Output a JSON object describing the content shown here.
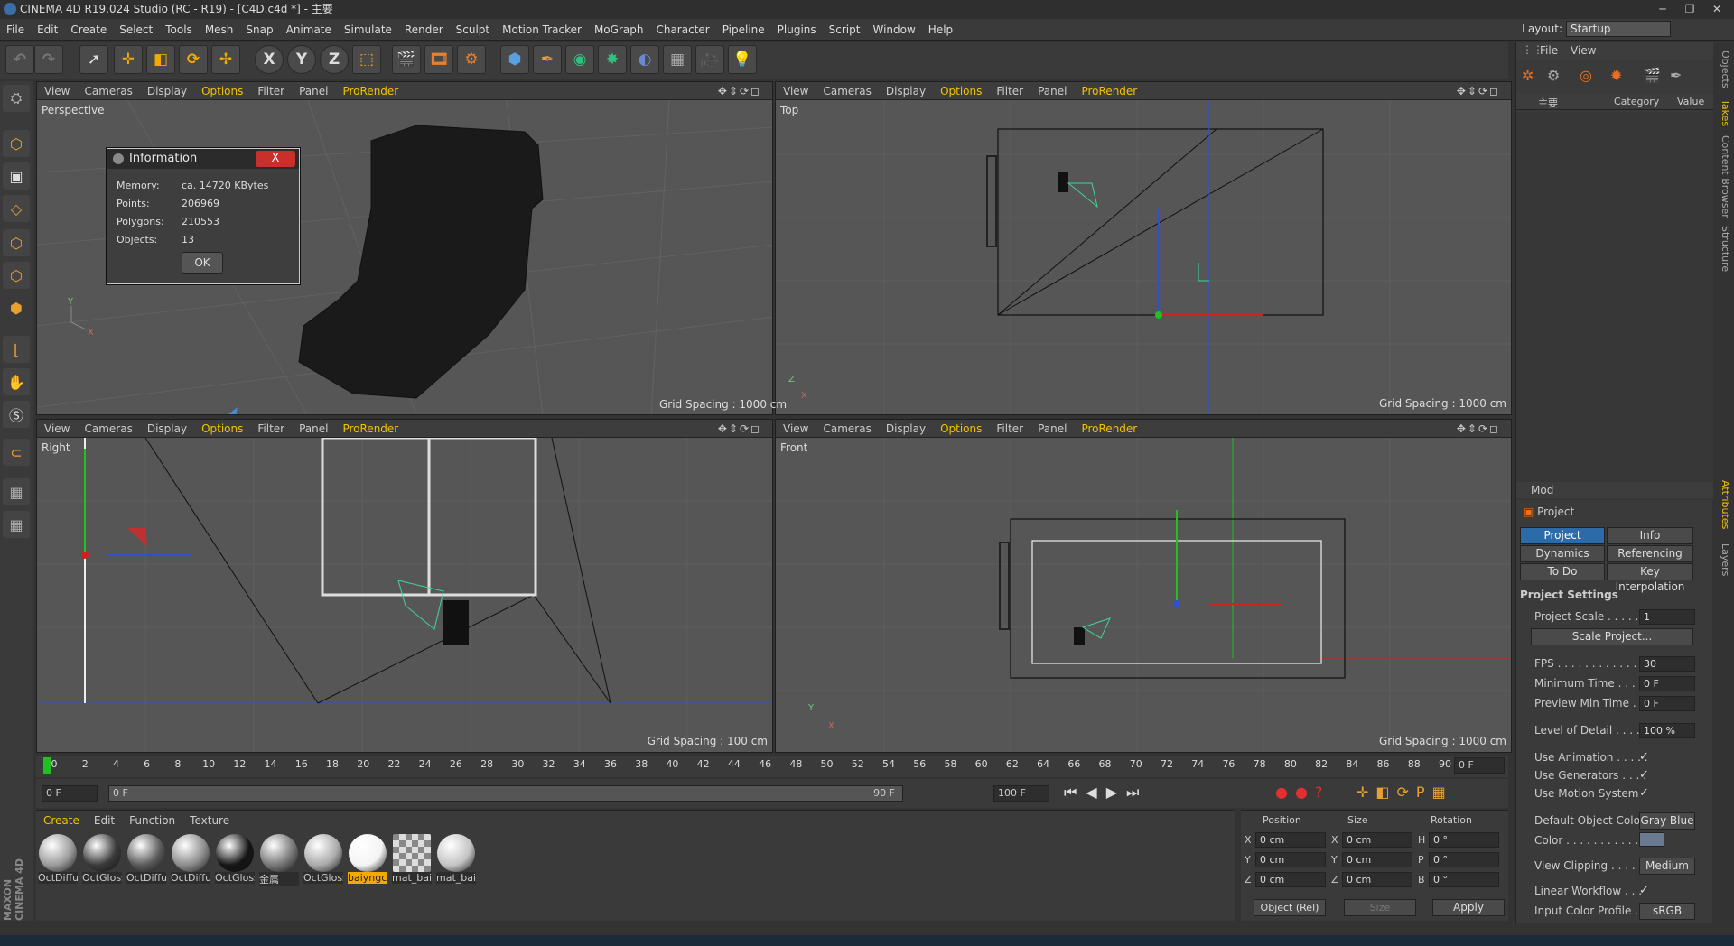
{
  "window": {
    "title": "CINEMA 4D R19.024 Studio (RC - R19) - [C4D.c4d *] - 主要"
  },
  "menu": [
    "File",
    "Edit",
    "Create",
    "Select",
    "Tools",
    "Mesh",
    "Snap",
    "Animate",
    "Simulate",
    "Render",
    "Sculpt",
    "Motion Tracker",
    "MoGraph",
    "Character",
    "Pipeline",
    "Plugins",
    "Script",
    "Window",
    "Help"
  ],
  "layout": {
    "label": "Layout:",
    "value": "Startup"
  },
  "toolbar_icons": [
    "undo-icon",
    "redo-icon",
    "select-icon",
    "move-icon",
    "scale-icon",
    "rotate-icon",
    "live-select-icon",
    "x-axis-icon",
    "y-axis-icon",
    "z-axis-icon",
    "coordinate-system-icon",
    "render-view-icon",
    "render-icon",
    "render-settings-icon",
    "cube-icon",
    "pen-icon",
    "subdivision-icon",
    "cloner-icon",
    "deformer-icon",
    "floor-icon",
    "camera-icon",
    "light-icon"
  ],
  "toolbar_labels": {
    "x": "X",
    "y": "Y",
    "z": "Z"
  },
  "viewport_menu": [
    "View",
    "Cameras",
    "Display",
    "Options",
    "Filter",
    "Panel",
    "ProRender"
  ],
  "viewport_nav": "✥⇕⟳◻",
  "viewports": [
    {
      "name": "Perspective",
      "grid": ""
    },
    {
      "name": "Top",
      "grid": "Grid Spacing : 1000 cm"
    },
    {
      "name": "Right",
      "grid": "Grid Spacing : 100 cm"
    },
    {
      "name": "Front",
      "grid": "Grid Spacing : 1000 cm"
    }
  ],
  "info_dialog": {
    "title": "Information",
    "close": "X",
    "rows": [
      {
        "label": "Memory:",
        "value": "ca. 14720 KBytes"
      },
      {
        "label": "Points:",
        "value": "206969"
      },
      {
        "label": "Polygons:",
        "value": "210553"
      },
      {
        "label": "Objects:",
        "value": "13"
      }
    ],
    "ok": "OK"
  },
  "objects_panel": {
    "menu": [
      "File",
      "View"
    ],
    "columns": [
      "主要",
      "Category",
      "Value"
    ]
  },
  "side_tabs": [
    "Objects",
    "Takes",
    "Content Browser",
    "Structure",
    "Attributes",
    "Layers"
  ],
  "attributes": {
    "mode": "Mod",
    "project": "Project",
    "tabs": [
      "Project Settings",
      "Info",
      "Dynamics",
      "Referencing",
      "To Do",
      "Key Interpolation"
    ],
    "section": "Project Settings",
    "project_scale": {
      "label": "Project Scale . . . . . .",
      "value": "1"
    },
    "scale_button": "Scale Project...",
    "fields": [
      {
        "label": "FPS . . . . . . . . . . . . . .",
        "value": "30"
      },
      {
        "label": "Minimum Time . . . . .",
        "value": "0 F"
      },
      {
        "label": "Preview Min Time . . .",
        "value": "0 F"
      },
      {
        "label": "Level of Detail . . . . .",
        "value": "100 %"
      }
    ],
    "checks": [
      {
        "label": "Use Animation . . . . .",
        "value": "✓"
      },
      {
        "label": "Use Generators . . . .",
        "value": "✓"
      },
      {
        "label": "Use Motion System",
        "value": "✓"
      }
    ],
    "default_color": {
      "label": "Default Object Color",
      "value": "Gray-Blue"
    },
    "color": {
      "label": "Color . . . . . . . . . . ."
    },
    "view_clipping": {
      "label": "View Clipping . . . . .",
      "value": "Medium"
    },
    "linear_workflow": {
      "label": "Linear Workflow . . .",
      "value": "✓"
    },
    "input_color": {
      "label": "Input Color Profile . .",
      "value": "sRGB"
    }
  },
  "timeline": {
    "ticks": [
      "0",
      "2",
      "4",
      "6",
      "8",
      "10",
      "12",
      "14",
      "16",
      "18",
      "20",
      "22",
      "24",
      "26",
      "28",
      "30",
      "32",
      "34",
      "36",
      "38",
      "40",
      "42",
      "44",
      "46",
      "48",
      "50",
      "52",
      "54",
      "56",
      "58",
      "60",
      "62",
      "64",
      "66",
      "68",
      "70",
      "72",
      "74",
      "76",
      "78",
      "80",
      "82",
      "84",
      "86",
      "88",
      "90"
    ],
    "current": "0 F",
    "start": "0 F",
    "range_start": "0 F",
    "range_end": "90 F",
    "end": "100 F"
  },
  "material_manager": {
    "menu": [
      "Create",
      "Edit",
      "Function",
      "Texture"
    ],
    "materials": [
      {
        "name": "OctDiffu",
        "color": "#9a9a9a"
      },
      {
        "name": "OctGloss",
        "color": "#3a3a3a"
      },
      {
        "name": "OctDiffu",
        "color": "#5a5a5a"
      },
      {
        "name": "OctDiffu",
        "color": "#8c8c8c"
      },
      {
        "name": "OctGloss",
        "color": "#151515"
      },
      {
        "name": "金属",
        "color": "#777777"
      },
      {
        "name": "OctGloss",
        "color": "#aaaaaa"
      },
      {
        "name": "baiyngc",
        "color": "#f4f4f4"
      },
      {
        "name": "mat_bai",
        "color": "checker"
      },
      {
        "name": "mat_bai",
        "color": "#c4c4c4"
      }
    ]
  },
  "coordinates": {
    "headers": [
      "Position",
      "Size",
      "Rotation"
    ],
    "rows": [
      {
        "axis": "X",
        "pos": "0 cm",
        "saxis": "X",
        "size": "0 cm",
        "raxis": "H",
        "rot": "0 °"
      },
      {
        "axis": "Y",
        "pos": "0 cm",
        "saxis": "Y",
        "size": "0 cm",
        "raxis": "P",
        "rot": "0 °"
      },
      {
        "axis": "Z",
        "pos": "0 cm",
        "saxis": "Z",
        "size": "0 cm",
        "raxis": "B",
        "rot": "0 °"
      }
    ],
    "mode": "Object (Rel)",
    "size_mode": "Size",
    "apply": "Apply"
  },
  "brand": "MAXON CINEMA 4D"
}
